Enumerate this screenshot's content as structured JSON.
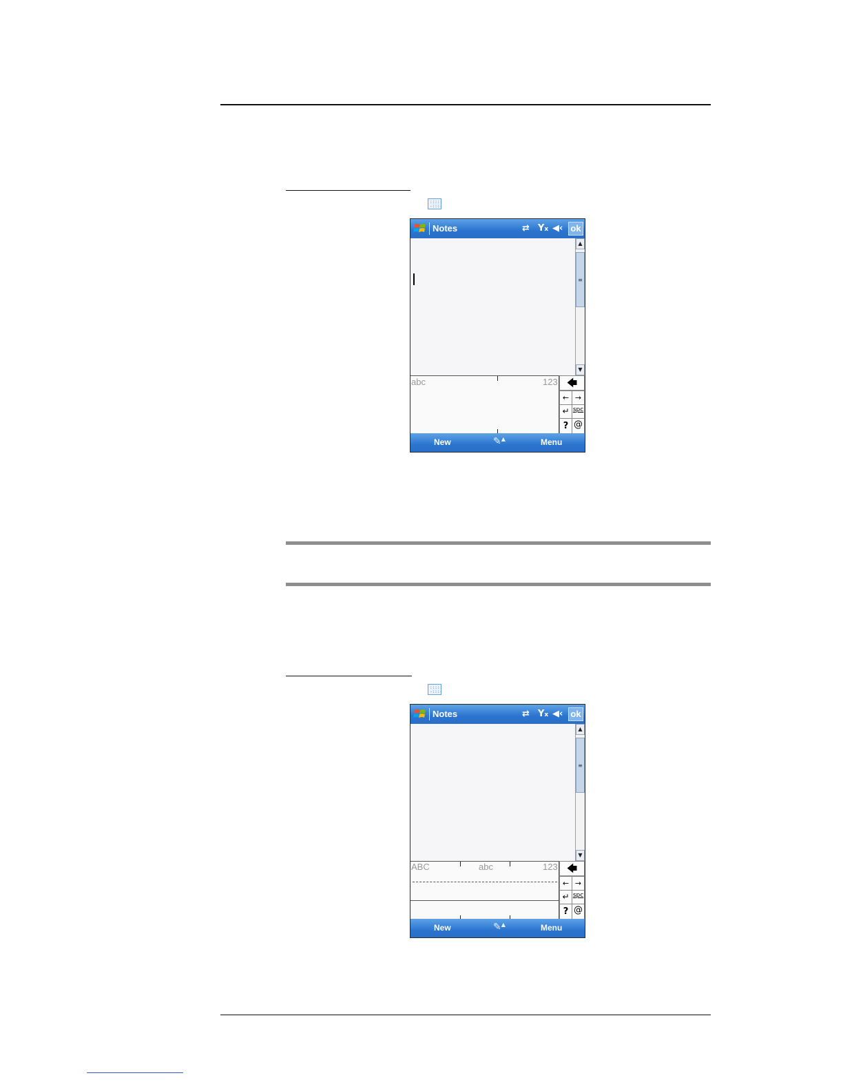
{
  "device1": {
    "title": "Notes",
    "ok_label": "ok",
    "input": {
      "left_label": "abc",
      "right_label": "123"
    },
    "keys": {
      "space": "spc",
      "help": "?",
      "symbols": "@"
    },
    "menu": {
      "left": "New",
      "right": "Menu"
    }
  },
  "device2": {
    "title": "Notes",
    "ok_label": "ok",
    "input": {
      "label_upper": "ABC",
      "label_lower": "abc",
      "label_num": "123"
    },
    "keys": {
      "space": "spc",
      "help": "?",
      "symbols": "@"
    },
    "menu": {
      "left": "New",
      "right": "Menu"
    }
  },
  "icons": {
    "keyboard_icon": "keyboard-icon",
    "sync": "sync-arrows-icon",
    "signal": "no-signal-icon",
    "volume": "speaker-icon",
    "windows": "windows-logo-icon",
    "pen": "pen-input-icon"
  },
  "colors": {
    "titlebar": "#2b74cf",
    "accent": "#5ea2e6",
    "rule": "#8e8e8e"
  }
}
